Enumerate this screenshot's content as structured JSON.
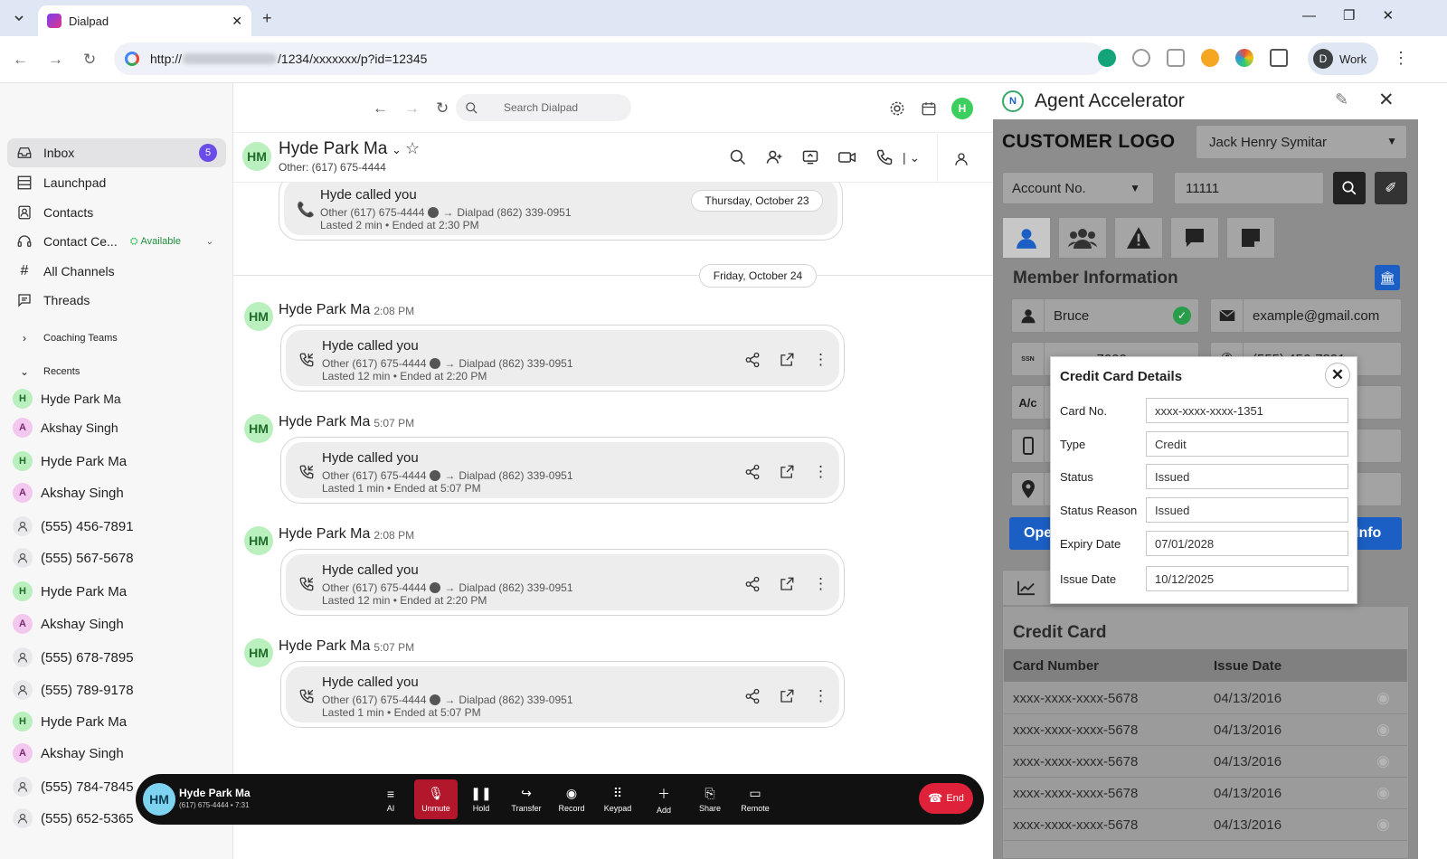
{
  "browser": {
    "tab_title": "Dialpad",
    "url_prefix": "http://",
    "url_suffix": "/1234/xxxxxxx/p?id=12345",
    "profile_initial": "D",
    "profile_label": "Work"
  },
  "app": {
    "search_placeholder": "Search Dialpad",
    "user_initial": "H"
  },
  "sidebar": {
    "nav": [
      {
        "label": "Inbox",
        "badge": "5"
      },
      {
        "label": "Launchpad"
      },
      {
        "label": "Contacts"
      },
      {
        "label": "Contact Ce...",
        "status": "Available"
      },
      {
        "label": "All Channels"
      },
      {
        "label": "Threads"
      }
    ],
    "coaching_label": "Coaching Teams",
    "recents_label": "Recents",
    "recents": [
      {
        "initial": "H",
        "name": "Hyde Park Ma"
      },
      {
        "initial": "A",
        "name": "Akshay Singh"
      },
      {
        "initial": "H",
        "name": "Hyde Park Ma"
      },
      {
        "initial": "A",
        "name": "Akshay Singh"
      },
      {
        "initial": "",
        "name": "(555) 456-7891"
      },
      {
        "initial": "",
        "name": "(555) 567-5678"
      },
      {
        "initial": "H",
        "name": "Hyde Park Ma"
      },
      {
        "initial": "A",
        "name": "Akshay Singh"
      },
      {
        "initial": "",
        "name": "(555) 678-7895"
      },
      {
        "initial": "",
        "name": "(555) 789-9178"
      },
      {
        "initial": "H",
        "name": "Hyde Park Ma"
      },
      {
        "initial": "A",
        "name": "Akshay Singh"
      },
      {
        "initial": "",
        "name": "(555) 784-7845"
      },
      {
        "initial": "",
        "name": "(555) 652-5365"
      }
    ]
  },
  "conversation": {
    "avatar": "HM",
    "name": "Hyde Park Ma",
    "subtitle": "Other: (617) 675-4444",
    "date_oct23": "Thursday, October 23",
    "date_oct24": "Friday, October 24",
    "top_call": {
      "title": "Hyde called you",
      "line1": "Other (617) 675-4444",
      "line1b": "Dialpad (862) 339-0951",
      "line2": "Lasted 2 min • Ended at 2:30 PM"
    },
    "messages": [
      {
        "sender": "Hyde Park Ma",
        "time": "2:08 PM",
        "title": "Hyde called you",
        "line1": "Other (617) 675-4444",
        "line1b": "Dialpad (862) 339-0951",
        "line2": "Lasted 12 min • Ended at 2:20 PM"
      },
      {
        "sender": "Hyde Park Ma",
        "time": "5:07 PM",
        "title": "Hyde called you",
        "line1": "Other (617) 675-4444",
        "line1b": "Dialpad (862) 339-0951",
        "line2": "Lasted 1 min • Ended at 5:07 PM"
      },
      {
        "sender": "Hyde Park Ma",
        "time": "2:08 PM",
        "title": "Hyde called you",
        "line1": "Other (617) 675-4444",
        "line1b": "Dialpad (862) 339-0951",
        "line2": "Lasted 12 min • Ended at 2:20 PM"
      },
      {
        "sender": "Hyde Park Ma",
        "time": "5:07 PM",
        "title": "Hyde called you",
        "line1": "Other (617) 675-4444",
        "line1b": "Dialpad (862) 339-0951",
        "line2": "Lasted 1 min • Ended at 5:07 PM"
      }
    ]
  },
  "callbar": {
    "avatar": "HM",
    "name": "Hyde Park Ma",
    "detail": "(617) 675-4444 • 7:31",
    "buttons": [
      "AI",
      "Unmute",
      "Hold",
      "Transfer",
      "Record",
      "Keypad",
      "Add",
      "Share",
      "Remote"
    ],
    "end_label": "End"
  },
  "panel": {
    "title": "Agent Accelerator",
    "logo_text": "CUSTOMER LOGO",
    "system_select": "Jack Henry Symitar",
    "search_type": "Account No.",
    "search_value": "11111",
    "section_member": "Member Information",
    "first_name": "Bruce",
    "email": "example@gmail.com",
    "ssn_label": "SSN",
    "ssn_value": "xxx-xx-7000",
    "phone_value": "(555) 456-7891",
    "ac_label": "A/c",
    "open_button": "Ope",
    "info_button": "Info",
    "section_credit": "Credit Card",
    "table_headers": [
      "Card Number",
      "Issue Date"
    ],
    "rows": [
      {
        "card": "xxxx-xxxx-xxxx-5678",
        "date": "04/13/2016"
      },
      {
        "card": "xxxx-xxxx-xxxx-5678",
        "date": "04/13/2016"
      },
      {
        "card": "xxxx-xxxx-xxxx-5678",
        "date": "04/13/2016"
      },
      {
        "card": "xxxx-xxxx-xxxx-5678",
        "date": "04/13/2016"
      },
      {
        "card": "xxxx-xxxx-xxxx-5678",
        "date": "04/13/2016"
      }
    ]
  },
  "modal": {
    "title": "Credit Card Details",
    "fields": [
      {
        "label": "Card No.",
        "value": "xxxx-xxxx-xxxx-1351"
      },
      {
        "label": "Type",
        "value": "Credit"
      },
      {
        "label": "Status",
        "value": "Issued"
      },
      {
        "label": "Status Reason",
        "value": "Issued"
      },
      {
        "label": "Expiry Date",
        "value": "07/01/2028"
      },
      {
        "label": "Issue Date",
        "value": "10/12/2025"
      }
    ]
  },
  "colors": {
    "accent_purple": "#6b4ce6",
    "available_green": "#2fbf4e",
    "end_red": "#e0213a",
    "unmute_red": "#b3172c",
    "panel_blue": "#1b5fc4"
  }
}
